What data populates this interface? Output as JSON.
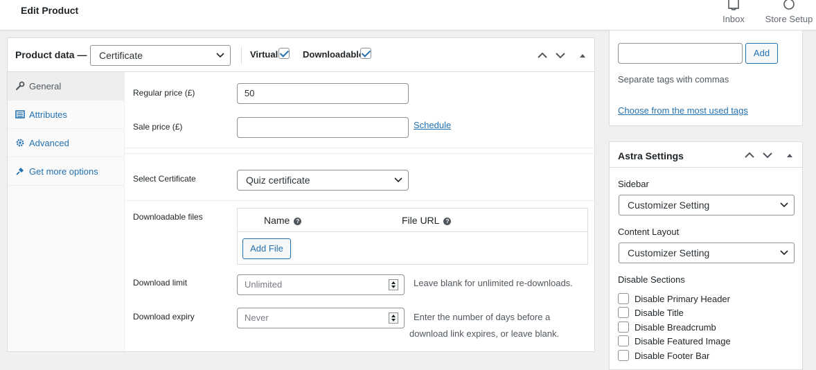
{
  "header": {
    "title": "Edit Product",
    "actions": [
      {
        "label": "Inbox",
        "icon": "inbox-icon"
      },
      {
        "label": "Store Setup",
        "icon": "store-setup-icon"
      }
    ]
  },
  "product_data": {
    "title": "Product data —",
    "product_type": "Certificate",
    "virtual_label": "Virtual:",
    "virtual_checked": true,
    "downloadable_label": "Downloadable:",
    "downloadable_checked": true,
    "tabs": [
      {
        "label": "General",
        "icon": "wrench-icon",
        "active": true
      },
      {
        "label": "Attributes",
        "icon": "list-icon",
        "active": false
      },
      {
        "label": "Advanced",
        "icon": "gear-icon",
        "active": false
      },
      {
        "label": "Get more options",
        "icon": "plugin-icon",
        "active": false
      }
    ],
    "regular_price": {
      "label": "Regular price (£)",
      "value": "50"
    },
    "sale_price": {
      "label": "Sale price (£)",
      "value": "",
      "schedule_link": "Schedule"
    },
    "certificate": {
      "label": "Select Certificate",
      "value": "Quiz certificate"
    },
    "downloadable_files": {
      "label": "Downloadable files",
      "col_name": "Name",
      "col_url": "File URL",
      "add_button": "Add File"
    },
    "download_limit": {
      "label": "Download limit",
      "placeholder": "Unlimited",
      "help": "Leave blank for unlimited re-downloads."
    },
    "download_expiry": {
      "label": "Download expiry",
      "placeholder": "Never",
      "help_line1": "Enter the number of days before a",
      "help_line2": "download link expires, or leave blank."
    }
  },
  "tags": {
    "input_value": "",
    "add_button": "Add",
    "hint": "Separate tags with commas",
    "most_used_link": "Choose from the most used tags"
  },
  "astra": {
    "title": "Astra Settings",
    "sidebar_label": "Sidebar",
    "sidebar_value": "Customizer Setting",
    "content_layout_label": "Content Layout",
    "content_layout_value": "Customizer Setting",
    "disable_sections_label": "Disable Sections",
    "options": [
      "Disable Primary Header",
      "Disable Title",
      "Disable Breadcrumb",
      "Disable Featured Image",
      "Disable Footer Bar"
    ]
  },
  "colors": {
    "accent": "#2271b1",
    "text": "#1d2327",
    "border": "#dcdcde",
    "background": "#f0f0f1"
  }
}
